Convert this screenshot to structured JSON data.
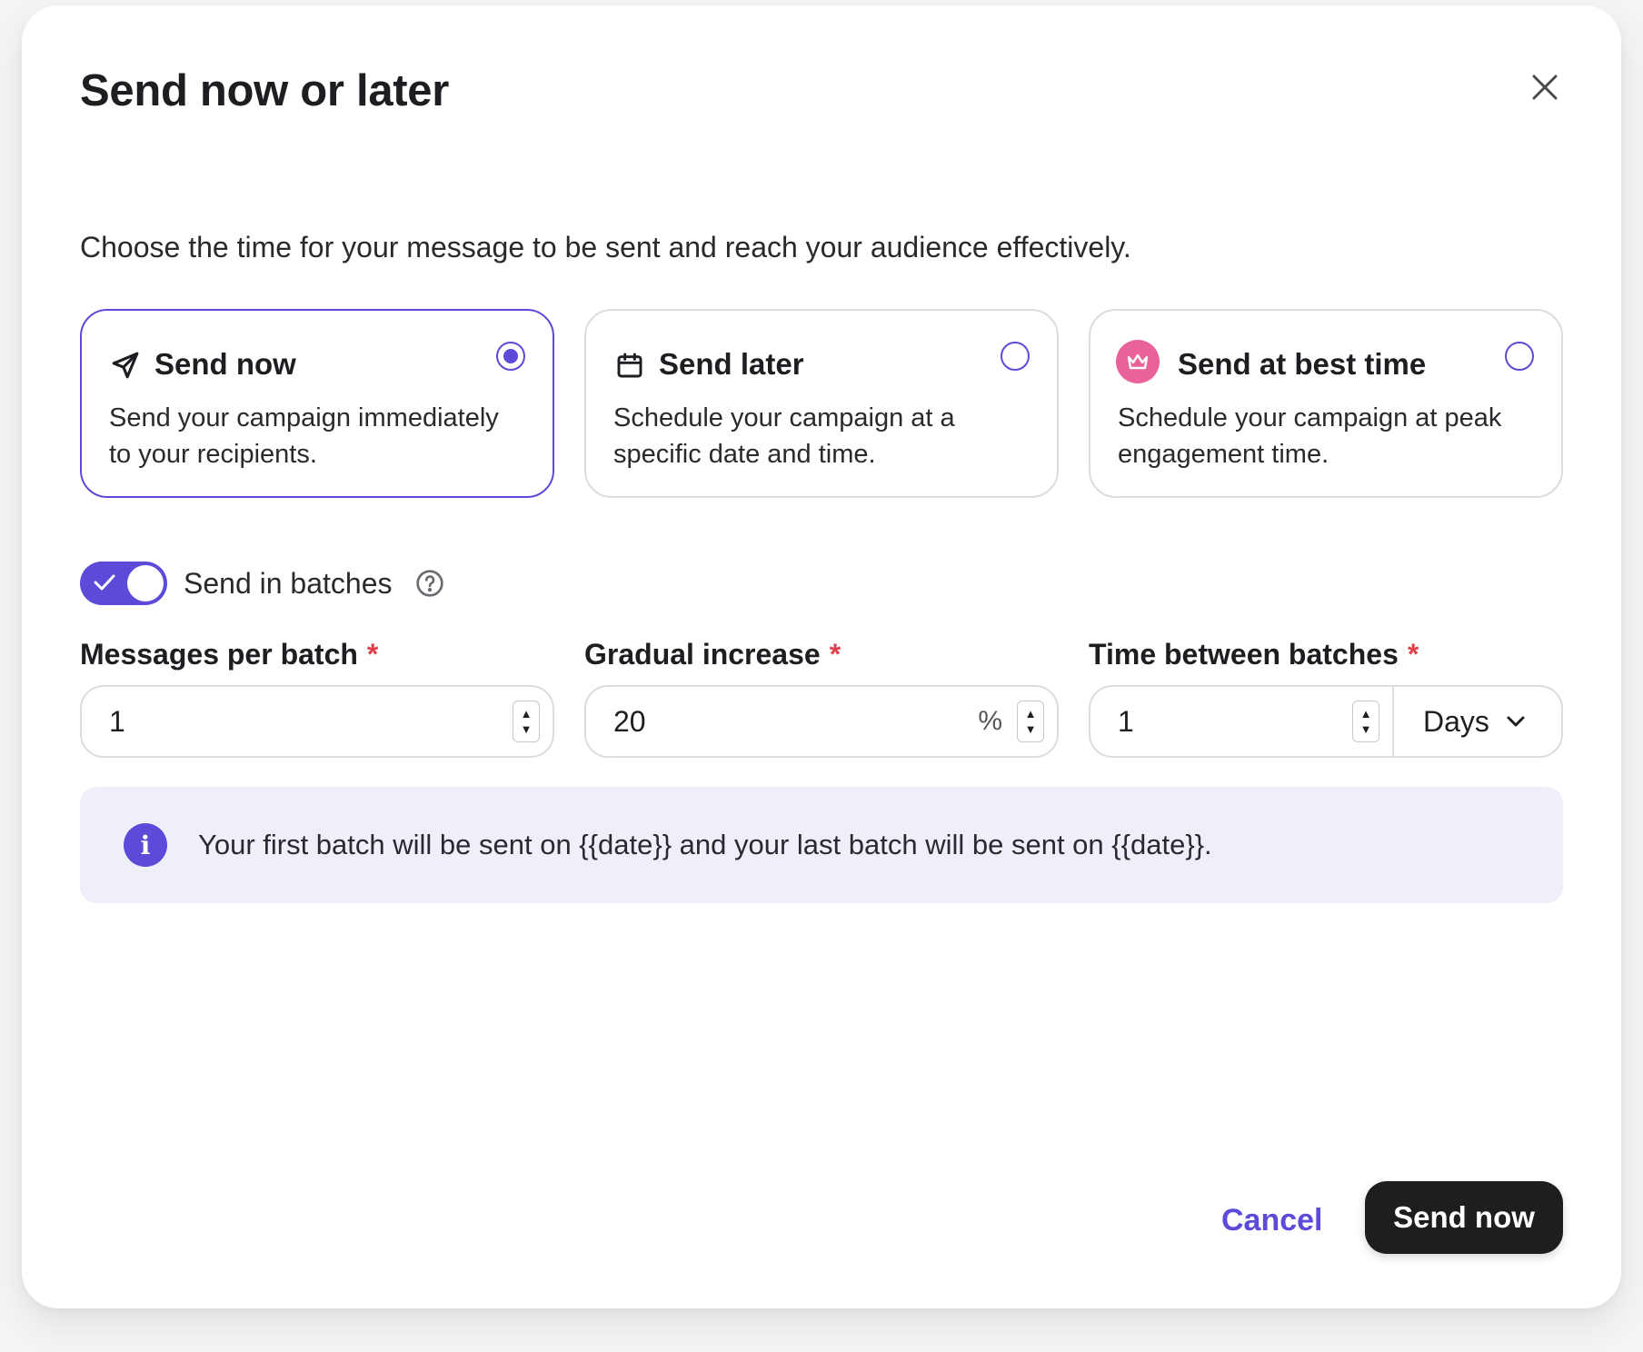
{
  "dialog": {
    "title": "Send now or later",
    "subtitle": "Choose the time for your message to be sent and reach your audience effectively."
  },
  "options": [
    {
      "title": "Send now",
      "description": "Send your campaign immediately to your recipients.",
      "icon": "send-icon",
      "selected": true
    },
    {
      "title": "Send later",
      "description": "Schedule your campaign at a specific date and time.",
      "icon": "calendar-icon",
      "selected": false
    },
    {
      "title": "Send at best time",
      "description": "Schedule your campaign at peak engagement time.",
      "icon": "crown-icon",
      "selected": false
    }
  ],
  "batches": {
    "toggle_label": "Send in batches",
    "enabled": true
  },
  "fields": {
    "messages_per_batch": {
      "label": "Messages per batch",
      "required_mark": "*",
      "value": "1"
    },
    "gradual_increase": {
      "label": "Gradual increase",
      "required_mark": "*",
      "value": "20",
      "suffix": "%"
    },
    "time_between_batches": {
      "label": "Time between batches",
      "required_mark": "*",
      "value": "1",
      "unit": "Days"
    }
  },
  "info": {
    "text": "Your first batch will be sent on {{date}} and your last batch will be sent on {{date}}."
  },
  "footer": {
    "cancel_label": "Cancel",
    "submit_label": "Send now"
  },
  "colors": {
    "accent": "#5b4bd8",
    "required": "#e0404a",
    "crown_bg": "#e9629a",
    "info_bg": "#efeffa",
    "primary_button": "#1e1e20"
  }
}
